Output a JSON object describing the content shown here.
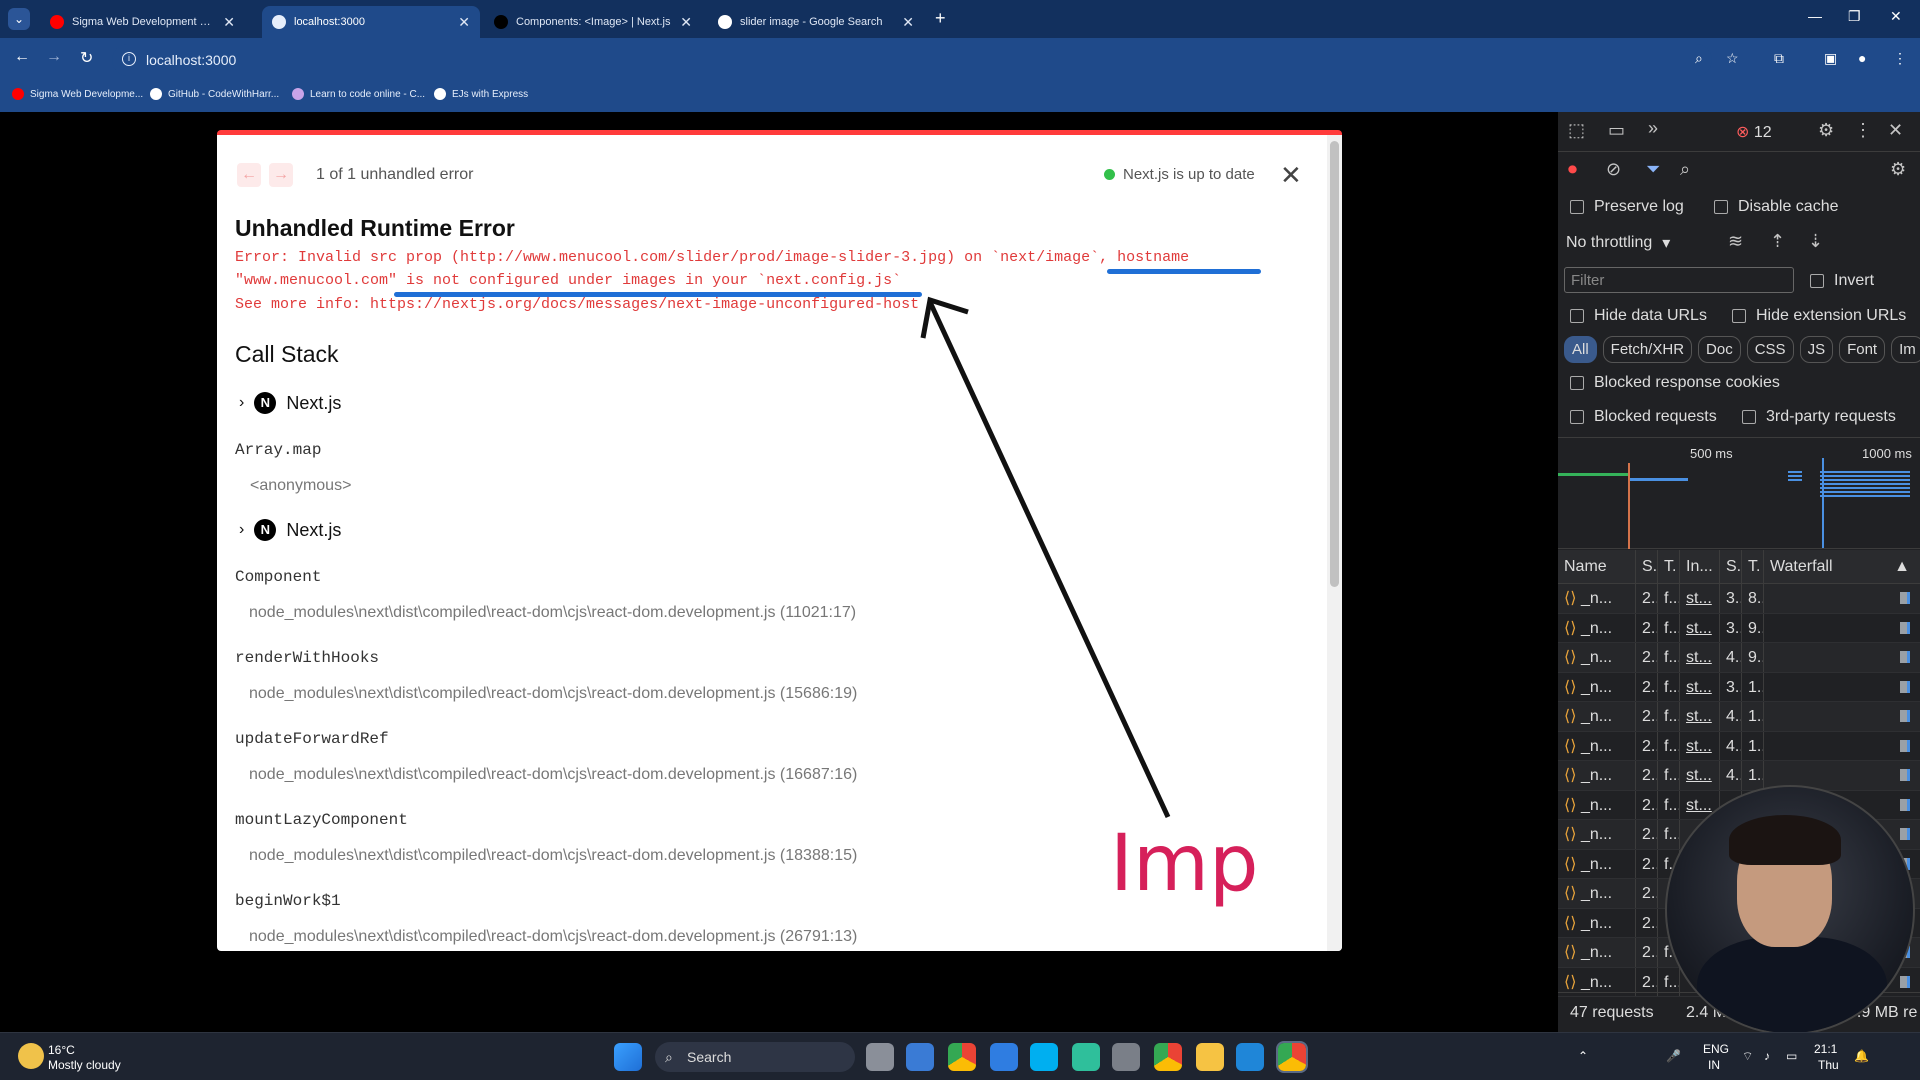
{
  "browser": {
    "tabs": [
      {
        "title": "Sigma Web Development Course - W",
        "favicon_color": "#ff0000"
      },
      {
        "title": "localhost:3000",
        "favicon_color": "#e6eefb"
      },
      {
        "title": "Components: <Image> | Next.js",
        "favicon_color": "#000000"
      },
      {
        "title": "slider image - Google Search",
        "favicon_color": "#ffffff"
      }
    ],
    "url": "localhost:3000",
    "bookmarks": [
      "Sigma Web Developme...",
      "GitHub - CodeWithHarr...",
      "Learn to code online - C...",
      "EJs with Express"
    ]
  },
  "overlay": {
    "count_text": "1 of 1 unhandled error",
    "status_text": "Next.js is up to date",
    "title": "Unhandled Runtime Error",
    "error_line1": "Error: Invalid src prop (http://www.menucool.com/slider/prod/image-slider-3.jpg) on `next/image`, hostname",
    "error_line2": "\"www.menucool.com\" is not configured under images in your `next.config.js`",
    "error_line3": "See more info: https://nextjs.org/docs/messages/next-image-unconfigured-host",
    "call_stack_title": "Call Stack",
    "frames": [
      {
        "kind": "group",
        "label": "Next.js"
      },
      {
        "kind": "fn",
        "name": "Array.map",
        "location": "<anonymous>"
      },
      {
        "kind": "group",
        "label": "Next.js"
      },
      {
        "kind": "fn",
        "name": "Component",
        "location": "node_modules\\next\\dist\\compiled\\react-dom\\cjs\\react-dom.development.js (11021:17)"
      },
      {
        "kind": "fn",
        "name": "renderWithHooks",
        "location": "node_modules\\next\\dist\\compiled\\react-dom\\cjs\\react-dom.development.js (15686:19)"
      },
      {
        "kind": "fn",
        "name": "updateForwardRef",
        "location": "node_modules\\next\\dist\\compiled\\react-dom\\cjs\\react-dom.development.js (16687:16)"
      },
      {
        "kind": "fn",
        "name": "mountLazyComponent",
        "location": "node_modules\\next\\dist\\compiled\\react-dom\\cjs\\react-dom.development.js (18388:15)"
      },
      {
        "kind": "fn",
        "name": "beginWork$1",
        "location": "node_modules\\next\\dist\\compiled\\react-dom\\cjs\\react-dom.development.js (26791:13)"
      }
    ]
  },
  "annotation": {
    "text": "Imp",
    "color": "#d6205a"
  },
  "devtools": {
    "error_count": "12",
    "preserve_log": "Preserve log",
    "disable_cache": "Disable cache",
    "throttling": "No throttling",
    "filter_placeholder": "Filter",
    "invert": "Invert",
    "hide_data_urls": "Hide data URLs",
    "hide_extension_urls": "Hide extension URLs",
    "type_filters": [
      "All",
      "Fetch/XHR",
      "Doc",
      "CSS",
      "JS",
      "Font",
      "Im"
    ],
    "blocked_cookies": "Blocked response cookies",
    "blocked_requests": "Blocked requests",
    "third_party": "3rd-party requests",
    "timeline_labels": [
      "500 ms",
      "1000 ms"
    ],
    "columns": [
      "Name",
      "S.",
      "T.",
      "In...",
      "S.",
      "T.",
      "Waterfall"
    ],
    "rows": [
      [
        "_n...",
        "2..",
        "f...",
        "st...",
        "3..",
        "8.."
      ],
      [
        "_n...",
        "2..",
        "f...",
        "st...",
        "3..",
        "9.."
      ],
      [
        "_n...",
        "2..",
        "f...",
        "st...",
        "4..",
        "9.."
      ],
      [
        "_n...",
        "2..",
        "f...",
        "st...",
        "3..",
        "1.."
      ],
      [
        "_n...",
        "2..",
        "f...",
        "st...",
        "4..",
        "1.."
      ],
      [
        "_n...",
        "2..",
        "f...",
        "st...",
        "4..",
        "1.."
      ],
      [
        "_n...",
        "2..",
        "f...",
        "st...",
        "4..",
        "1.."
      ],
      [
        "_n...",
        "2..",
        "f...",
        "st...",
        "",
        ""
      ],
      [
        "_n...",
        "2..",
        "f...",
        "",
        "",
        ""
      ],
      [
        "_n...",
        "2..",
        "f...",
        "",
        "",
        ""
      ],
      [
        "_n...",
        "2..",
        "",
        "",
        "",
        ""
      ],
      [
        "_n...",
        "2..",
        "",
        "",
        "",
        ""
      ],
      [
        "_n...",
        "2..",
        "f...",
        "",
        "",
        ""
      ],
      [
        "_n...",
        "2..",
        "f...",
        "",
        "",
        ""
      ]
    ],
    "requests": "47 requests",
    "transferred": "2.4 MB",
    "resources": "9.9 MB re"
  },
  "taskbar": {
    "weather_temp": "16°C",
    "weather_desc": "Mostly cloudy",
    "search": "Search",
    "lang": "ENG",
    "region": "IN",
    "time": "21:1",
    "day": "Thu"
  }
}
